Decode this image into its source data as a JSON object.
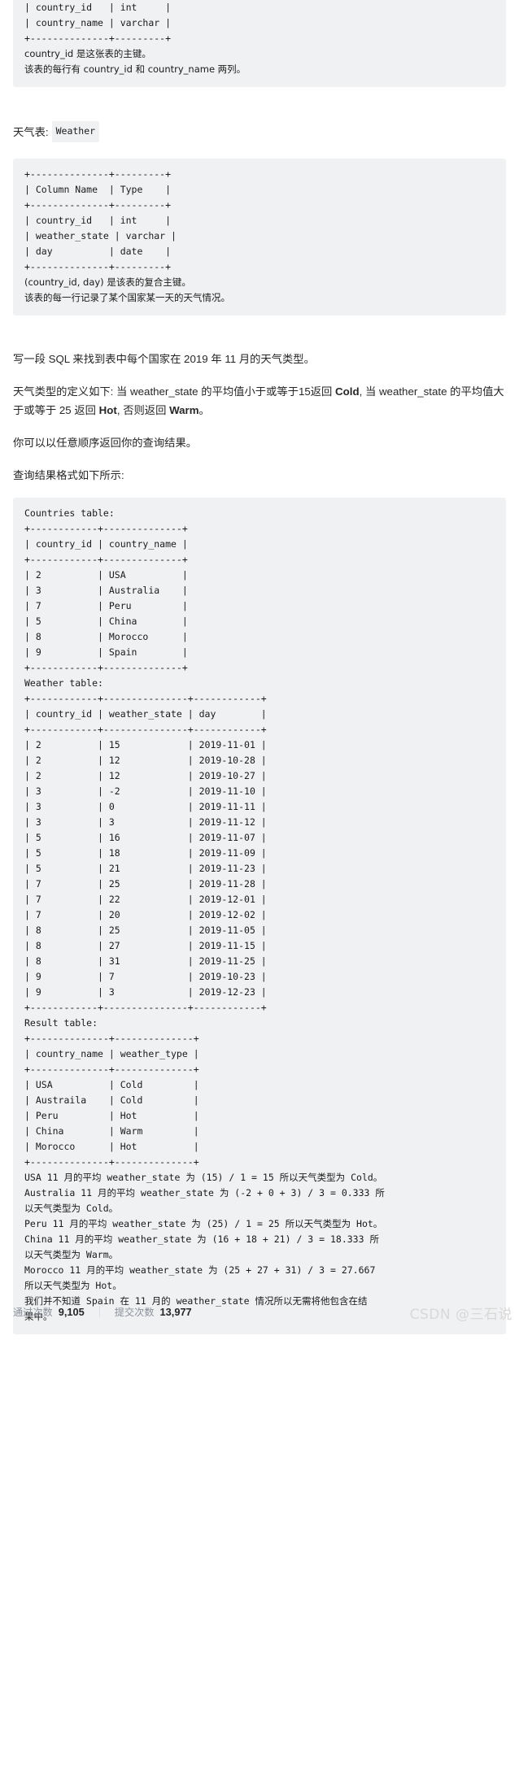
{
  "colors": {
    "code_bg": "#f0f1f2",
    "text": "#262626",
    "muted": "#8a8f99",
    "watermark": "#d8d8d8"
  },
  "countries_schema_block": {
    "lines": [
      "+--------------+---------+",
      "| country_id   | int     |",
      "| country_name | varchar |",
      "+--------------+---------+"
    ],
    "notes": [
      "country_id 是这张表的主键。",
      "该表的每行有 country_id 和 country_name 两列。"
    ]
  },
  "weather_table_label": {
    "prefix": "天气表:",
    "code": "Weather"
  },
  "weather_schema_block": {
    "lines": [
      "+--------------+---------+",
      "| Column Name  | Type    |",
      "+--------------+---------+",
      "| country_id   | int     |",
      "| weather_state | varchar |",
      "| day          | date    |",
      "+--------------+---------+"
    ],
    "notes": [
      "(country_id, day) 是该表的复合主键。",
      "该表的每一行记录了某个国家某一天的天气情况。"
    ]
  },
  "prompt": {
    "p1": "写一段 SQL 来找到表中每个国家在 2019 年 11 月的天气类型。",
    "p2_a": "天气类型的定义如下: 当 weather_state 的平均值小于或等于15返回 ",
    "p2_b": "Cold",
    "p2_c": ", 当 weather_state 的平均值大于或等于 25 返回 ",
    "p2_d": "Hot",
    "p2_e": ", 否则返回 ",
    "p2_f": "Warm",
    "p2_g": "。",
    "p3": "你可以以任意顺序返回你的查询结果。",
    "p4": "查询结果格式如下所示:"
  },
  "example_block": {
    "countries_caption": "Countries table:",
    "countries_border": "+------------+--------------+",
    "countries_header": "| country_id | country_name |",
    "countries_rows": [
      "| 2          | USA          |",
      "| 3          | Australia    |",
      "| 7          | Peru         |",
      "| 5          | China        |",
      "| 8          | Morocco      |",
      "| 9          | Spain        |"
    ],
    "weather_caption": "Weather table:",
    "weather_border": "+------------+---------------+------------+",
    "weather_header": "| country_id | weather_state | day        |",
    "weather_rows": [
      "| 2          | 15            | 2019-11-01 |",
      "| 2          | 12            | 2019-10-28 |",
      "| 2          | 12            | 2019-10-27 |",
      "| 3          | -2            | 2019-11-10 |",
      "| 3          | 0             | 2019-11-11 |",
      "| 3          | 3             | 2019-11-12 |",
      "| 5          | 16            | 2019-11-07 |",
      "| 5          | 18            | 2019-11-09 |",
      "| 5          | 21            | 2019-11-23 |",
      "| 7          | 25            | 2019-11-28 |",
      "| 7          | 22            | 2019-12-01 |",
      "| 7          | 20            | 2019-12-02 |",
      "| 8          | 25            | 2019-11-05 |",
      "| 8          | 27            | 2019-11-15 |",
      "| 8          | 31            | 2019-11-25 |",
      "| 9          | 7             | 2019-10-23 |",
      "| 9          | 3             | 2019-12-23 |"
    ],
    "result_caption": "Result table:",
    "result_border": "+--------------+--------------+",
    "result_header": "| country_name | weather_type |",
    "result_rows": [
      "| USA          | Cold         |",
      "| Austraila    | Cold         |",
      "| Peru         | Hot          |",
      "| China        | Warm         |",
      "| Morocco      | Hot          |"
    ],
    "explanation": [
      "USA 11 月的平均 weather_state 为 (15) / 1 = 15 所以天气类型为 Cold。",
      "Australia 11 月的平均 weather_state 为 (-2 + 0 + 3) / 3 = 0.333 所",
      "以天气类型为 Cold。",
      "Peru 11 月的平均 weather_state 为 (25) / 1 = 25 所以天气类型为 Hot。",
      "China 11 月的平均 weather_state 为 (16 + 18 + 21) / 3 = 18.333 所",
      "以天气类型为 Warm。",
      "Morocco 11 月的平均 weather_state 为 (25 + 27 + 31) / 3 = 27.667",
      "所以天气类型为 Hot。",
      "我们并不知道 Spain 在 11 月的 weather_state 情况所以无需将他包含在结",
      "果中。"
    ]
  },
  "footer": {
    "accepted_label": "通过次数",
    "accepted_value": "9,105",
    "submissions_label": "提交次数",
    "submissions_value": "13,977",
    "watermark": "CSDN @三石说"
  }
}
